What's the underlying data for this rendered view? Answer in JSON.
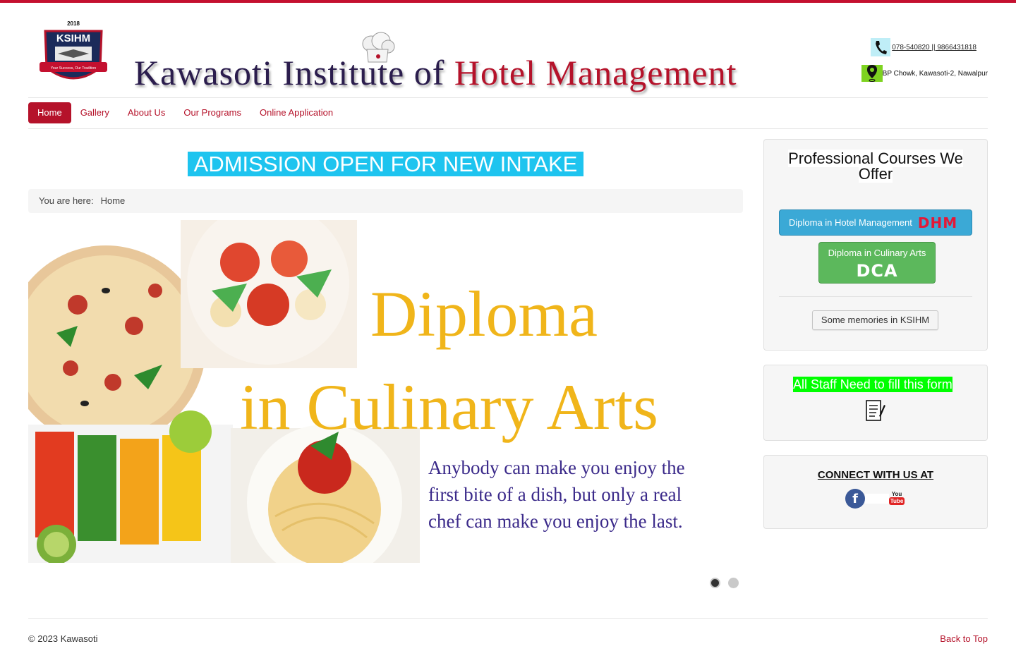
{
  "header": {
    "logo": {
      "year": "2018",
      "name": "KSIHM",
      "tagline": "Your Success, Our Tradition"
    },
    "brand": {
      "part1": "Kawasoti Institute of ",
      "part2": "Hotel Management"
    },
    "phone": "078-540820 || 9866431818",
    "address": "BP Chowk, Kawasoti-2, Nawalpur"
  },
  "nav": {
    "items": [
      {
        "label": "Home",
        "active": true
      },
      {
        "label": "Gallery"
      },
      {
        "label": "About Us"
      },
      {
        "label": "Our Programs"
      },
      {
        "label": "Online Application"
      }
    ]
  },
  "main": {
    "admission_banner": "ADMISSION OPEN FOR NEW INTAKE",
    "breadcrumb": {
      "prefix": "You are here:",
      "current": "Home"
    },
    "slide": {
      "title_line1": "Diploma",
      "title_line2": "in Culinary Arts",
      "quote": "Anybody can make you enjoy the first bite of a dish, but only a real chef can make you enjoy the last."
    },
    "slider_dots": {
      "count": 2,
      "active_index": 0
    }
  },
  "sidebar": {
    "courses": {
      "title": "Professional Courses We Offer",
      "dhm_label": "Diploma in Hotel Management",
      "dhm_tag": "DHM",
      "dca_label": "Diploma in Culinary Arts",
      "dca_tag": "DCA",
      "memories_label": "Some memories in KSIHM"
    },
    "staff": {
      "text": "All Staff Need to fill this form",
      "icon": "form-icon"
    },
    "connect": {
      "title": "CONNECT WITH US AT",
      "facebook_icon": "facebook-icon",
      "youtube_you": "You",
      "youtube_tube": "Tube"
    }
  },
  "footer": {
    "copyright": "© 2023 Kawasoti",
    "back_to_top": "Back to Top"
  },
  "colors": {
    "brand_red": "#b5122a",
    "banner_cyan": "#1ec4ef",
    "btn_blue": "#3ba9d6",
    "btn_green": "#5cb85c",
    "staff_green": "#00ff00"
  }
}
